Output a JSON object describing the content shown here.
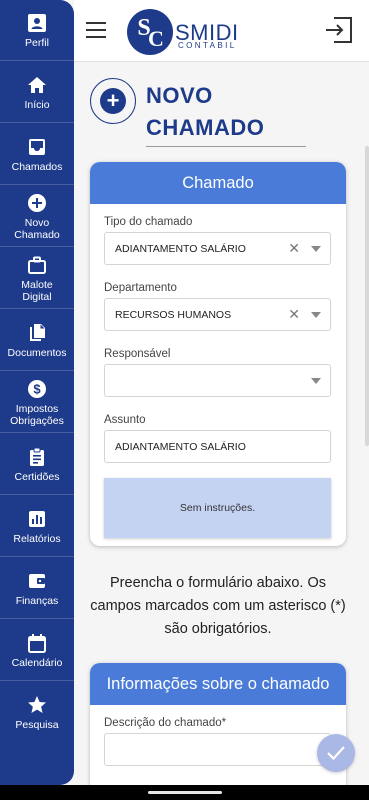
{
  "sidebar": {
    "items": [
      {
        "label": "Perfil",
        "icon": "profile-icon"
      },
      {
        "label": "Início",
        "icon": "home-icon"
      },
      {
        "label": "Chamados",
        "icon": "inbox-icon"
      },
      {
        "label": "Novo\nChamado",
        "icon": "add-circle-icon"
      },
      {
        "label": "Malote\nDigital",
        "icon": "briefcase-icon"
      },
      {
        "label": "Documentos",
        "icon": "documents-icon"
      },
      {
        "label": "Impostos\nObrigações",
        "icon": "dollar-icon"
      },
      {
        "label": "Certidões",
        "icon": "clipboard-icon"
      },
      {
        "label": "Relatórios",
        "icon": "bar-chart-icon"
      },
      {
        "label": "Finanças",
        "icon": "wallet-icon"
      },
      {
        "label": "Calendário",
        "icon": "calendar-icon"
      },
      {
        "label": "Pesquisa",
        "icon": "star-icon"
      }
    ]
  },
  "header": {
    "logo_text": "SMIDI",
    "logo_sub": "CONTABIL",
    "logo_mark": "SC"
  },
  "page": {
    "title": "NOVO CHAMADO"
  },
  "card_chamado": {
    "title": "Chamado",
    "tipo_label": "Tipo do chamado",
    "tipo_value": "ADIANTAMENTO SALÁRIO",
    "depto_label": "Departamento",
    "depto_value": "RECURSOS HUMANOS",
    "resp_label": "Responsável",
    "resp_value": "",
    "assunto_label": "Assunto",
    "assunto_value": "ADIANTAMENTO SALÁRIO",
    "instructions": "Sem instruções."
  },
  "note": "Preencha o formulário abaixo. Os campos marcados com um asterisco (*) são obrigatórios.",
  "card_info": {
    "title": "Informações sobre o chamado",
    "descricao_label": "Descrição do chamado*"
  },
  "colors": {
    "primary": "#1e3a8a",
    "card_header": "#4a7bd8",
    "instructions_bg": "#c5d3f2"
  }
}
